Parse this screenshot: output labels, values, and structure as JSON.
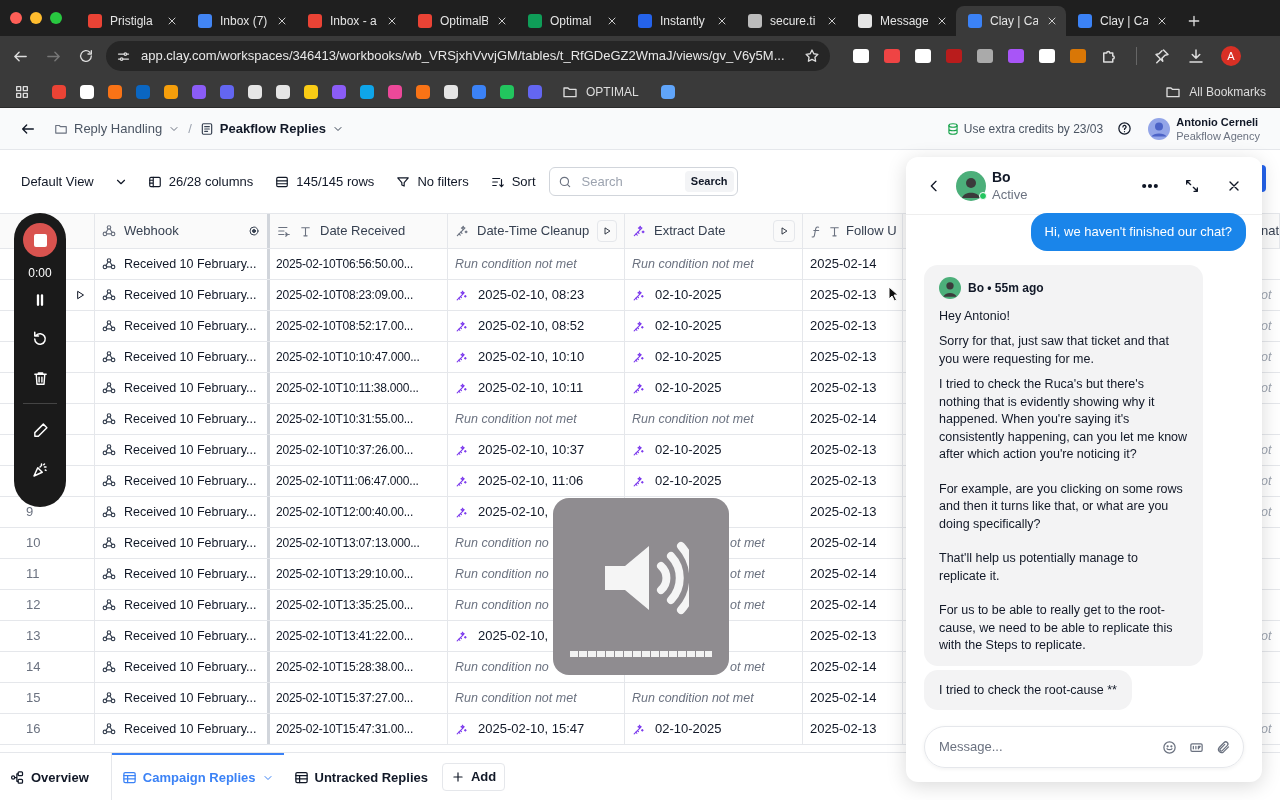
{
  "browser": {
    "tabs": [
      {
        "title": "Pristigla",
        "selected": false
      },
      {
        "title": "Inbox (7)",
        "selected": false
      },
      {
        "title": "Inbox - a",
        "selected": false
      },
      {
        "title": "OptimalB",
        "selected": false
      },
      {
        "title": "Optimal",
        "selected": false
      },
      {
        "title": "Instantly",
        "selected": false
      },
      {
        "title": "secure.ti",
        "selected": false
      },
      {
        "title": "Message",
        "selected": false
      },
      {
        "title": "Clay | Ca",
        "selected": true
      },
      {
        "title": "Clay | Ca",
        "selected": false
      }
    ],
    "url": "app.clay.com/workspaces/346413/workbooks/wb_VRSjxhVvvjGM/tables/t_RfGDeGZ2WmaJ/views/gv_V6y5M...",
    "profile_initial": "A",
    "bookmark_folder": "OPTIMAL",
    "all_bookmarks": "All Bookmarks"
  },
  "header": {
    "breadcrumbs": [
      "Reply Handling",
      "Peakflow Replies"
    ],
    "separator": "/",
    "credits": "Use extra credits by 23/03",
    "user": {
      "name": "Antonio Cerneli",
      "org": "Peakflow Agency"
    }
  },
  "toolbar": {
    "view": "Default View",
    "columns": "26/28 columns",
    "rows": "145/145 rows",
    "filters": "No filters",
    "sort": "Sort",
    "search": {
      "placeholder": "Search",
      "button": "Search"
    }
  },
  "table": {
    "columns": [
      {
        "label": "Webhook"
      },
      {
        "label": "Date Received"
      },
      {
        "label": "Date-Time Cleanup"
      },
      {
        "label": "Extract Date"
      },
      {
        "label": "Follow U"
      },
      {
        "label": "nat"
      }
    ],
    "rows": [
      {
        "hovered": false,
        "webhook": "Received 10 February...",
        "date_received": "2025-02-10T06:56:50.00...",
        "cleanup": {
          "kind": "not_met",
          "text": "Run condition not met"
        },
        "extract": {
          "kind": "not_met",
          "text": "Run condition not met"
        },
        "follow_up": "2025-02-14"
      },
      {
        "hovered": true,
        "webhook": "Received 10 February...",
        "date_received": "2025-02-10T08:23:09.00...",
        "cleanup": {
          "kind": "value",
          "text": "2025-02-10, 08:23"
        },
        "extract": {
          "kind": "value",
          "text": "02-10-2025"
        },
        "follow_up": "2025-02-13",
        "column_7": "ot"
      },
      {
        "hovered": false,
        "webhook": "Received 10 February...",
        "date_received": "2025-02-10T08:52:17.00...",
        "cleanup": {
          "kind": "value",
          "text": "2025-02-10, 08:52"
        },
        "extract": {
          "kind": "value",
          "text": "02-10-2025"
        },
        "follow_up": "2025-02-13",
        "column_7": "ot"
      },
      {
        "hovered": false,
        "webhook": "Received 10 February...",
        "date_received": "2025-02-10T10:10:47.000...",
        "cleanup": {
          "kind": "value",
          "text": "2025-02-10, 10:10"
        },
        "extract": {
          "kind": "value",
          "text": "02-10-2025"
        },
        "follow_up": "2025-02-13",
        "column_7": "ot"
      },
      {
        "hovered": false,
        "webhook": "Received 10 February...",
        "date_received": "2025-02-10T10:11:38.000...",
        "cleanup": {
          "kind": "value",
          "text": "2025-02-10, 10:11"
        },
        "extract": {
          "kind": "value",
          "text": "02-10-2025"
        },
        "follow_up": "2025-02-13",
        "column_7": "ot"
      },
      {
        "hovered": false,
        "webhook": "Received 10 February...",
        "date_received": "2025-02-10T10:31:55.00...",
        "cleanup": {
          "kind": "not_met",
          "text": "Run condition not met"
        },
        "extract": {
          "kind": "not_met",
          "text": "Run condition not met"
        },
        "follow_up": "2025-02-14"
      },
      {
        "hovered": false,
        "webhook": "Received 10 February...",
        "date_received": "2025-02-10T10:37:26.00...",
        "cleanup": {
          "kind": "value",
          "text": "2025-02-10, 10:37"
        },
        "extract": {
          "kind": "value",
          "text": "02-10-2025"
        },
        "follow_up": "2025-02-13",
        "column_7": "ot"
      },
      {
        "hovered": false,
        "webhook": "Received 10 February...",
        "date_received": "2025-02-10T11:06:47.000...",
        "cleanup": {
          "kind": "value",
          "text": "2025-02-10, 11:06"
        },
        "extract": {
          "kind": "value",
          "text": "02-10-2025"
        },
        "follow_up": "2025-02-13",
        "column_7": "ot"
      },
      {
        "number": "9",
        "hovered": false,
        "webhook": "Received 10 February...",
        "date_received": "2025-02-10T12:00:40.00...",
        "cleanup": {
          "kind": "value",
          "text": "2025-02-10,"
        },
        "follow_up": "2025-02-13",
        "column_7": "ot"
      },
      {
        "number": "10",
        "hovered": false,
        "webhook": "Received 10 February...",
        "date_received": "2025-02-10T13:07:13.000...",
        "cleanup": {
          "kind": "not_met",
          "text": "Run condition no"
        },
        "extract": {
          "kind": "not_met_tail",
          "text": "ot met"
        },
        "follow_up": "2025-02-14"
      },
      {
        "number": "11",
        "hovered": false,
        "webhook": "Received 10 February...",
        "date_received": "2025-02-10T13:29:10.00...",
        "cleanup": {
          "kind": "not_met",
          "text": "Run condition no"
        },
        "extract": {
          "kind": "not_met_tail",
          "text": "ot met"
        },
        "follow_up": "2025-02-14"
      },
      {
        "number": "12",
        "hovered": false,
        "webhook": "Received 10 February...",
        "date_received": "2025-02-10T13:35:25.00...",
        "cleanup": {
          "kind": "not_met",
          "text": "Run condition no"
        },
        "extract": {
          "kind": "not_met_tail",
          "text": "ot met"
        },
        "follow_up": "2025-02-14"
      },
      {
        "number": "13",
        "hovered": false,
        "webhook": "Received 10 February...",
        "date_received": "2025-02-10T13:41:22.00...",
        "cleanup": {
          "kind": "value",
          "text": "2025-02-10,"
        },
        "follow_up": "2025-02-13",
        "column_7": "ot"
      },
      {
        "number": "14",
        "hovered": false,
        "webhook": "Received 10 February...",
        "date_received": "2025-02-10T15:28:38.00...",
        "cleanup": {
          "kind": "not_met",
          "text": "Run condition no"
        },
        "extract": {
          "kind": "not_met_tail",
          "text": "ot met"
        },
        "follow_up": "2025-02-14"
      },
      {
        "number": "15",
        "hovered": false,
        "webhook": "Received 10 February...",
        "date_received": "2025-02-10T15:37:27.00...",
        "cleanup": {
          "kind": "not_met",
          "text": "Run condition not met"
        },
        "extract": {
          "kind": "not_met",
          "text": "Run condition not met"
        },
        "follow_up": "2025-02-14"
      },
      {
        "number": "16",
        "hovered": false,
        "webhook": "Received 10 February...",
        "date_received": "2025-02-10T15:47:31.00...",
        "cleanup": {
          "kind": "value",
          "text": "2025-02-10, 15:47"
        },
        "extract": {
          "kind": "value",
          "text": "02-10-2025"
        },
        "follow_up": "2025-02-13",
        "column_7": "ot"
      }
    ]
  },
  "recorder": {
    "time": "0:00"
  },
  "volume": {
    "level": 1
  },
  "chat": {
    "name": "Bo",
    "status": "Active",
    "outgoing": "Hi, we haven't finished our chat?",
    "message": {
      "author": "Bo • 55m ago",
      "paragraphs": [
        "Hey Antonio!",
        "Sorry for that, just saw that ticket and that you were requesting for me.",
        "I tried to check the Ruca's but there's nothing that is evidently showing why it happened. When you're saying it's consistently happening, can you let me know after which action you're noticing it?",
        "For example, are you clicking on some rows and then it turns like that, or what are you doing specifically?",
        "That'll help us potentially manage to replicate it.",
        "For us to be able to really get to the root-cause, we need to be able to replicate this with the Steps to replicate."
      ]
    },
    "followup": "I tried to check the root-cause **",
    "input": {
      "placeholder": "Message..."
    }
  },
  "bottom_tabs": [
    {
      "label": "Overview",
      "selected": false
    },
    {
      "label": "Campaign Replies",
      "selected": true
    },
    {
      "label": "Untracked Replies",
      "selected": false
    }
  ],
  "add_label": "Add"
}
